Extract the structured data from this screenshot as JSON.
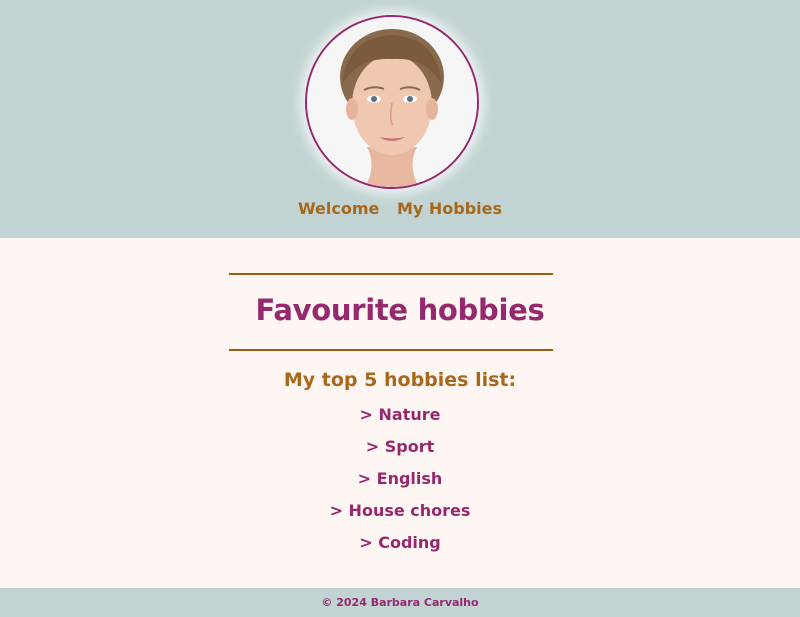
{
  "header": {
    "avatar_alt": "Barbara Carvalho",
    "nav": [
      {
        "label": "Welcome"
      },
      {
        "label": "My Hobbies"
      }
    ]
  },
  "main": {
    "title": "Favourite hobbies",
    "list_heading": "My top 5 hobbies list:",
    "hobbies": [
      "> Nature",
      "> Sport",
      "> English",
      "> House chores",
      "> Coding"
    ]
  },
  "footer": {
    "copyright": "© 2024 Barbara Carvalho"
  },
  "colors": {
    "header_bg": "#c1d3d2",
    "page_bg": "#fdf6f2",
    "accent_magenta": "#96296e",
    "accent_gold": "#a8681c",
    "rule": "#9c5a14"
  }
}
